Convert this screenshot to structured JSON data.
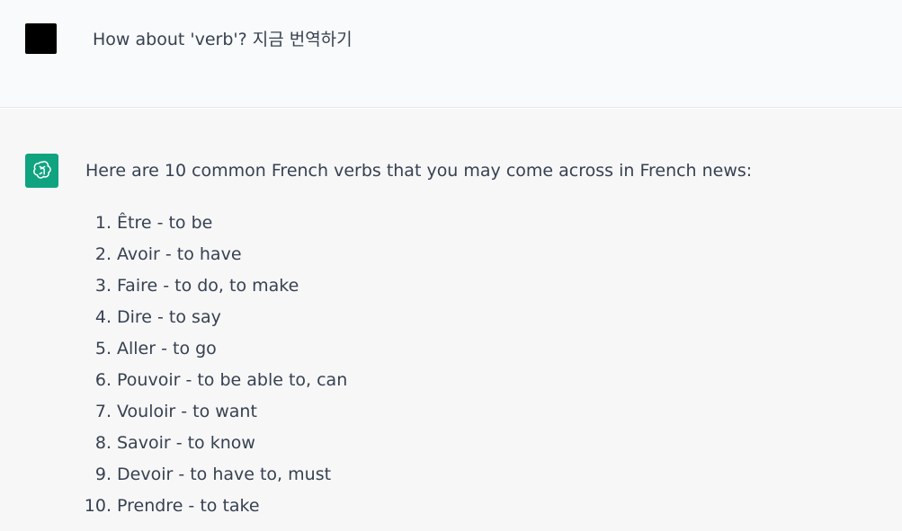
{
  "user_message": {
    "avatar_icon": "user-avatar-square",
    "text": "How about 'verb'? 지금 번역하기"
  },
  "assistant_message": {
    "avatar_icon": "chatgpt-logo-icon",
    "avatar_color": "#10a37f",
    "intro": "Here are 10 common French verbs that you may come across in French news:",
    "verbs": [
      {
        "num": "1.",
        "text": "Être - to be"
      },
      {
        "num": "2.",
        "text": "Avoir - to have"
      },
      {
        "num": "3.",
        "text": "Faire - to do, to make"
      },
      {
        "num": "4.",
        "text": "Dire - to say"
      },
      {
        "num": "5.",
        "text": "Aller - to go"
      },
      {
        "num": "6.",
        "text": "Pouvoir - to be able to, can"
      },
      {
        "num": "7.",
        "text": "Vouloir - to want"
      },
      {
        "num": "8.",
        "text": "Savoir - to know"
      },
      {
        "num": "9.",
        "text": "Devoir - to have to, must"
      },
      {
        "num": "10.",
        "text": "Prendre - to take"
      }
    ]
  }
}
